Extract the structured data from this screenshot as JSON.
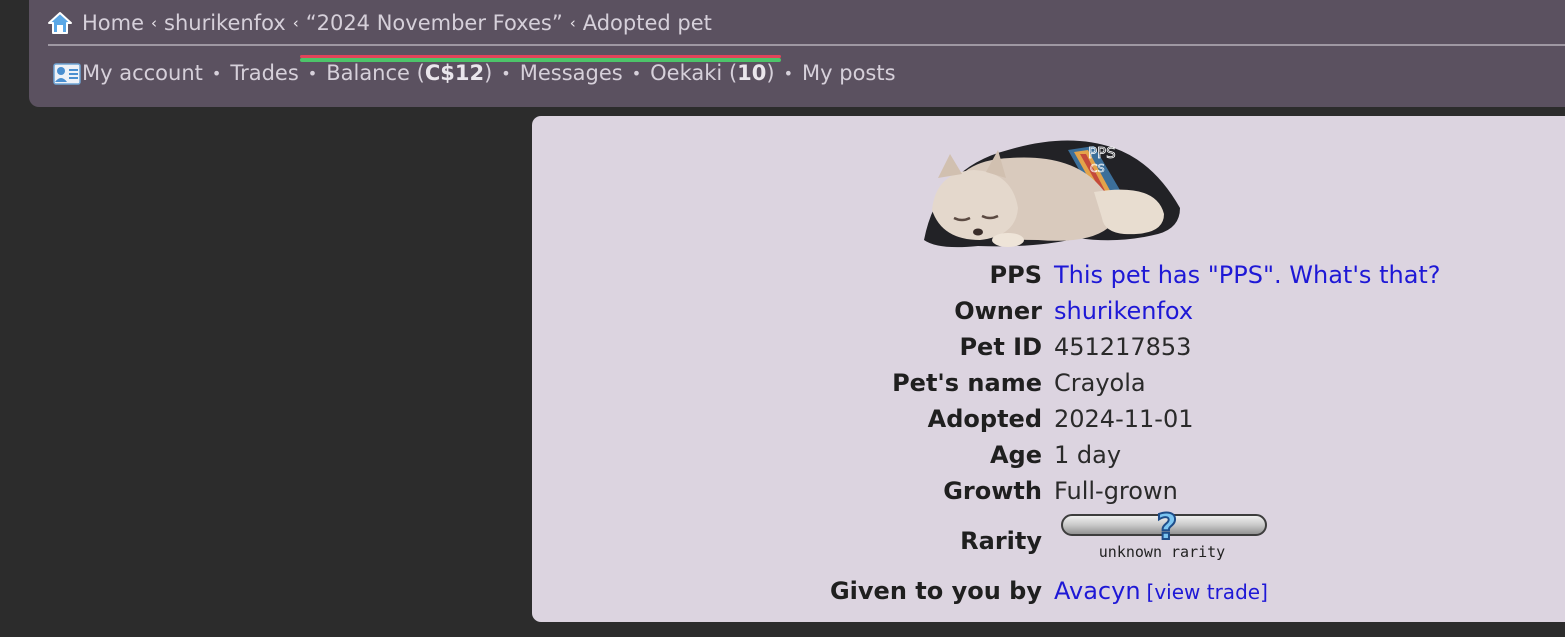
{
  "nav": {
    "breadcrumb": [
      {
        "label": "Home"
      },
      {
        "label": "shurikenfox"
      },
      {
        "label": "“2024 November Foxes”"
      },
      {
        "label": "Adopted pet"
      }
    ],
    "progress": {
      "red_fraction": 1.0,
      "green_fraction": 1.0
    },
    "user_links": {
      "my_account": "My account",
      "trades": "Trades",
      "balance_label": "Balance",
      "balance_value": "C$12",
      "messages": "Messages",
      "oekaki_label": "Oekaki",
      "oekaki_count": "10",
      "my_posts": "My posts"
    }
  },
  "pet": {
    "image_alt": "sleeping fox wearing cape",
    "image_watermark": "PPS CS",
    "fields": {
      "pps_label": "PPS",
      "pps_value": "This pet has \"PPS\". What's that?",
      "owner_label": "Owner",
      "owner_value": "shurikenfox",
      "pet_id_label": "Pet ID",
      "pet_id_value": "451217853",
      "name_label": "Pet's name",
      "name_value": "Crayola",
      "adopted_label": "Adopted",
      "adopted_value": "2024-11-01",
      "age_label": "Age",
      "age_value": "1 day",
      "growth_label": "Growth",
      "growth_value": "Full-grown",
      "rarity_label": "Rarity",
      "rarity_value": "unknown rarity",
      "given_label": "Given to you by",
      "given_value": "Avacyn",
      "view_trade": "[view trade]"
    }
  },
  "colors": {
    "page_bg": "#2c2c2c",
    "topbar_bg": "#5b5160",
    "panel_bg": "#dcd4e0",
    "link": "#1e18d6"
  }
}
